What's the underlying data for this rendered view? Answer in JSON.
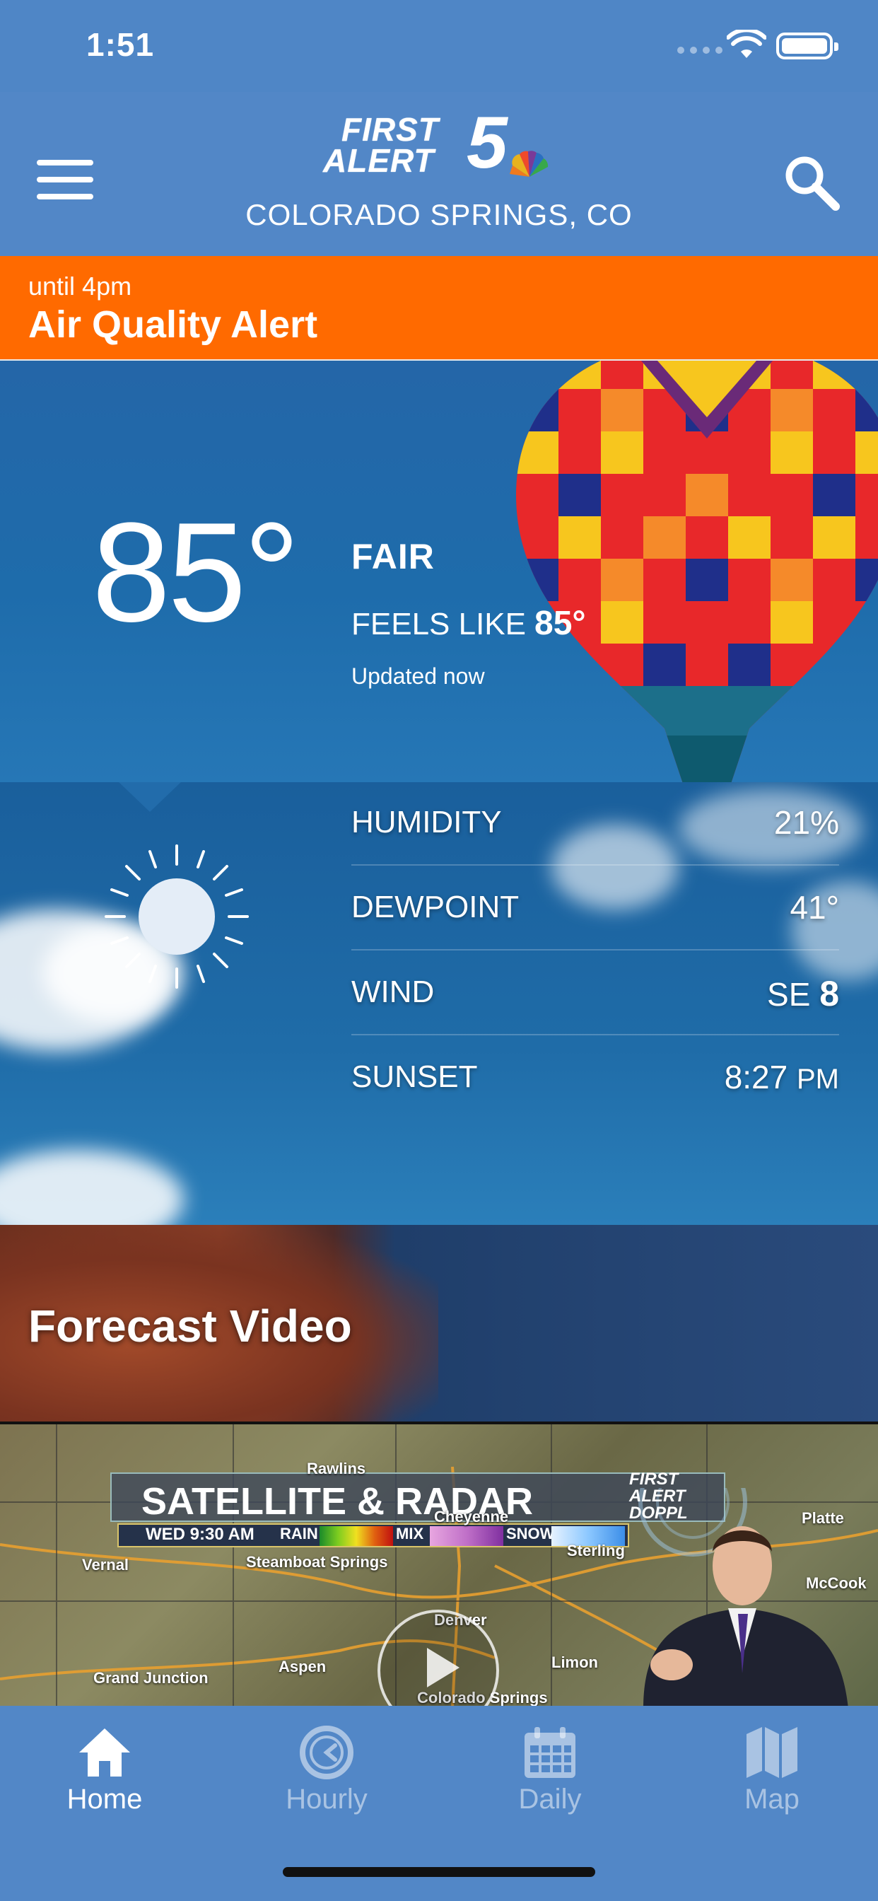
{
  "status_bar": {
    "time": "1:51"
  },
  "header": {
    "logo_line1": "FIRST",
    "logo_line2": "ALERT",
    "logo_number": "5",
    "location": "COLORADO SPRINGS, CO",
    "menu_icon": "hamburger-menu-icon",
    "search_icon": "search-icon"
  },
  "alert": {
    "until": "until 4pm",
    "title": "Air Quality Alert",
    "color": "#ff6a00"
  },
  "current": {
    "temperature": "85°",
    "condition": "FAIR",
    "feels_like_label": "FEELS LIKE",
    "feels_like_value": "85°",
    "updated": "Updated now",
    "icon": "sun-icon"
  },
  "details": [
    {
      "label": "HUMIDITY",
      "value": "21%",
      "prefix": "",
      "unit": ""
    },
    {
      "label": "DEWPOINT",
      "value": "41°",
      "prefix": "",
      "unit": ""
    },
    {
      "label": "WIND",
      "value": "8",
      "prefix": "SE",
      "unit": ""
    },
    {
      "label": "SUNSET",
      "value": "8:27",
      "prefix": "",
      "unit": "PM"
    }
  ],
  "forecast_video": {
    "title": "Forecast Video"
  },
  "radar_video": {
    "banner_title": "SATELLITE & RADAR",
    "date": "WED 9:30 AM",
    "legend_rain": "RAIN",
    "legend_mix": "MIX",
    "legend_snow": "SNOW",
    "logo_line1": "FIRST",
    "logo_line2": "ALERT",
    "logo_line3": "DOPPL",
    "towns": [
      "Vernal",
      "Steamboat Springs",
      "Sterling",
      "Platte",
      "McCook",
      "Denver",
      "Limon",
      "Grand Junction",
      "Aspen",
      "Colorado Springs",
      "Cheyenne",
      "Rawlins"
    ],
    "play_icon": "play-icon"
  },
  "tabs": [
    {
      "label": "Home",
      "icon": "home-icon",
      "active": true
    },
    {
      "label": "Hourly",
      "icon": "clock-icon",
      "active": false
    },
    {
      "label": "Daily",
      "icon": "calendar-icon",
      "active": false
    },
    {
      "label": "Map",
      "icon": "map-icon",
      "active": false
    }
  ]
}
